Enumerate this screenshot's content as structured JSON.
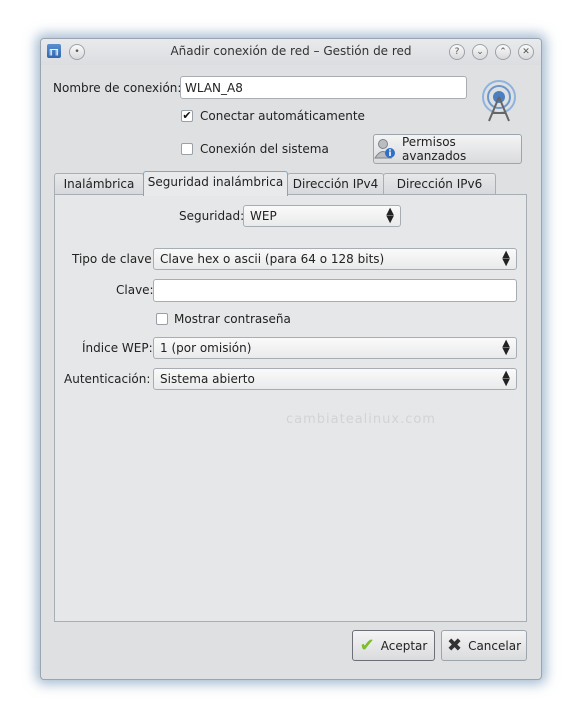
{
  "window": {
    "title": "Añadir conexión de red – Gestión de red",
    "icons": [
      "app-icon",
      "menu-circle-icon",
      "help-icon",
      "minimize-icon",
      "maximize-icon",
      "close-icon"
    ]
  },
  "connection": {
    "name_label": "Nombre de conexión:",
    "name_value": "WLAN_A8",
    "auto_connect_label": "Conectar automáticamente",
    "auto_connect_checked": true,
    "system_label": "Conexión del sistema",
    "system_checked": false,
    "advanced_permissions_label": "Permisos avanzados"
  },
  "tabs": [
    {
      "label": "Inalámbrica",
      "active": false
    },
    {
      "label": "Seguridad inalámbrica",
      "active": true
    },
    {
      "label": "Dirección IPv4",
      "active": false
    },
    {
      "label": "Dirección IPv6",
      "active": false
    }
  ],
  "security": {
    "security_label": "Seguridad:",
    "security_value": "WEP",
    "key_type_label": "Tipo de clave:",
    "key_type_value": "Clave hex o ascii (para 64 o 128 bits)",
    "key_label": "Clave:",
    "key_value": "",
    "show_password_label": "Mostrar contraseña",
    "show_password_checked": false,
    "wep_index_label": "Índice WEP:",
    "wep_index_value": "1 (por omisión)",
    "auth_label": "Autenticación:",
    "auth_value": "Sistema abierto"
  },
  "watermark": "cambiatealinux.com",
  "buttons": {
    "accept_label": "Aceptar",
    "cancel_label": "Cancelar"
  },
  "colors": {
    "window_bg": "#dfe0e2",
    "active_tab_border": "#7ca5d8",
    "accept_check": "#7bbf2a",
    "cancel_x": "#333333"
  }
}
